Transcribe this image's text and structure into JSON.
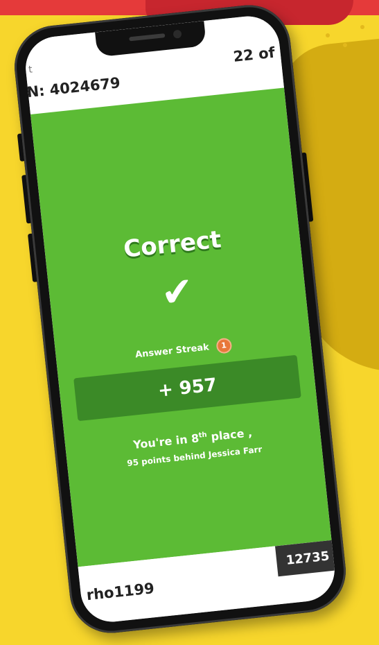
{
  "top_bar": {
    "partial_text": "t",
    "pin_label": "N: 4024679",
    "question_progress": "22 of"
  },
  "result": {
    "title": "Correct",
    "check_icon": "checkmark-icon",
    "streak_label": "Answer Streak",
    "streak_count": "1",
    "points": "+ 957",
    "place_prefix": "You're in 8",
    "place_suffix_sup": "th",
    "place_after": " place ,",
    "behind_text": "95 points behind Jessica Farr"
  },
  "bottom_bar": {
    "username": "rho1199",
    "total_score": "12735"
  },
  "colors": {
    "background": "#f7d62c",
    "result_green": "#5cbb35",
    "score_bar": "#3b8a27",
    "streak_badge": "#e8783a"
  }
}
